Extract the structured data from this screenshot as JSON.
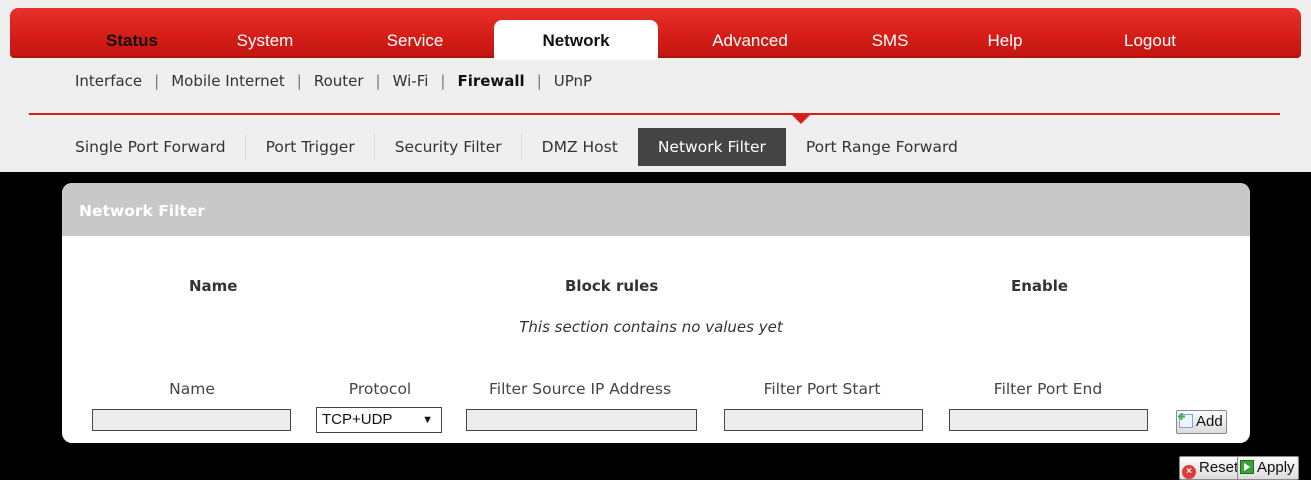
{
  "top_nav": {
    "items": [
      {
        "label": "Status"
      },
      {
        "label": "System"
      },
      {
        "label": "Service"
      },
      {
        "label": "Network"
      },
      {
        "label": "Advanced"
      },
      {
        "label": "SMS"
      },
      {
        "label": "Help"
      },
      {
        "label": "Logout"
      }
    ],
    "active": "Network"
  },
  "sub_nav": {
    "items": [
      {
        "label": "Interface"
      },
      {
        "label": "Mobile Internet"
      },
      {
        "label": "Router"
      },
      {
        "label": "Wi-Fi"
      },
      {
        "label": "Firewall"
      },
      {
        "label": "UPnP"
      }
    ],
    "separator": "|",
    "active": "Firewall"
  },
  "firewall_tabs": {
    "items": [
      {
        "label": "Single Port Forward"
      },
      {
        "label": "Port Trigger"
      },
      {
        "label": "Security Filter"
      },
      {
        "label": "DMZ Host"
      },
      {
        "label": "Network Filter"
      },
      {
        "label": "Port Range Forward"
      }
    ],
    "active": "Network Filter"
  },
  "panel": {
    "title": "Network Filter",
    "table_headers": [
      "Name",
      "Block rules",
      "Enable"
    ],
    "empty_message": "This section contains no values yet",
    "form_labels": [
      "Name",
      "Protocol",
      "Filter Source IP Address",
      "Filter Port Start",
      "Filter Port End"
    ],
    "fields": {
      "name": "",
      "protocol": "TCP+UDP",
      "source_ip": "",
      "port_start": "",
      "port_end": ""
    },
    "add_button": "Add"
  },
  "footer": {
    "reset_button": "Reset",
    "apply_button": "Apply"
  },
  "colors": {
    "nav_red": "#d71e18",
    "active_tab": "#444444",
    "panel_header": "#c8c8c8"
  }
}
